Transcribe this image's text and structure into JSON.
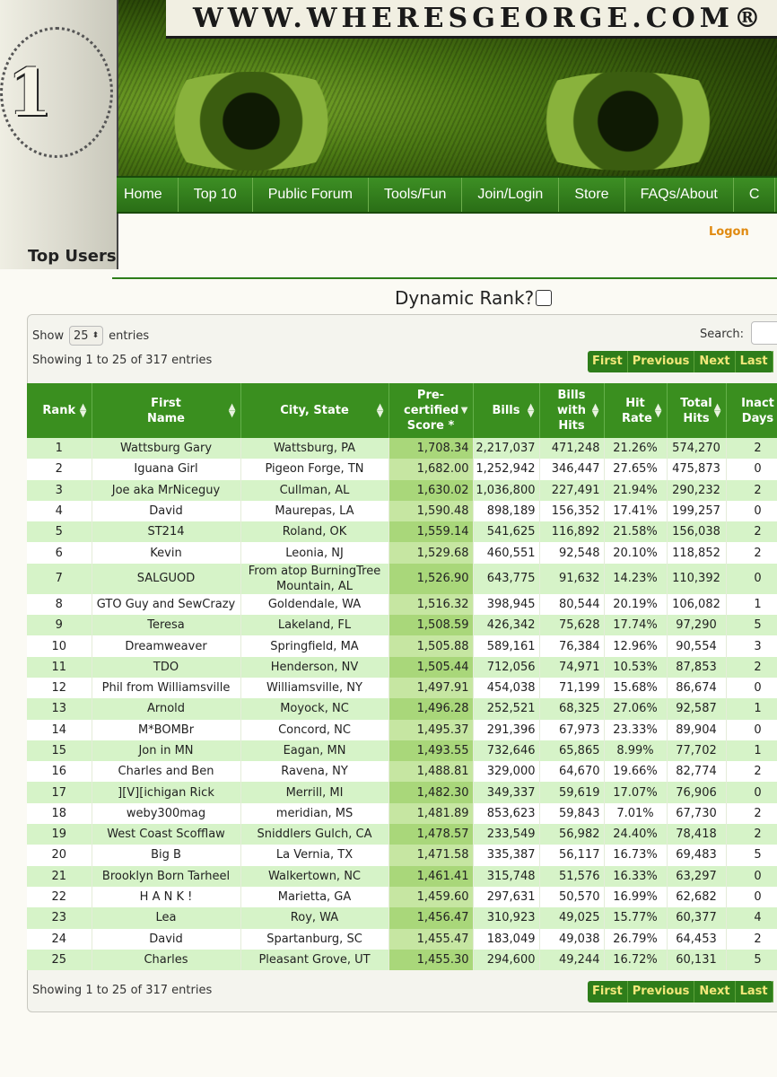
{
  "site": {
    "url_text": "WWW.WHERESGEORGE.COM®",
    "bill_numeral": "1"
  },
  "nav": [
    "Home",
    "Top 10",
    "Public Forum",
    "Tools/Fun",
    "Join/Login",
    "Store",
    "FAQs/About",
    "C"
  ],
  "logon": "Logon",
  "page_title": "Top Users",
  "dynamic_rank_label": "Dynamic Rank?",
  "controls": {
    "show_label": "Show",
    "entries_value": "25",
    "entries_label": "entries",
    "search_label": "Search:"
  },
  "info_text": "Showing 1 to 25 of 317 entries",
  "pager": [
    "First",
    "Previous",
    "Next",
    "Last"
  ],
  "columns": [
    {
      "label": "Rank",
      "sort": "both"
    },
    {
      "label": "First Name",
      "sort": "both"
    },
    {
      "label": "City, State",
      "sort": "both"
    },
    {
      "label": "Pre-certified Score *",
      "sort": "desc"
    },
    {
      "label": "Bills",
      "sort": "both"
    },
    {
      "label": "Bills with Hits",
      "sort": "both"
    },
    {
      "label": "Hit Rate",
      "sort": "both"
    },
    {
      "label": "Total Hits",
      "sort": "both"
    },
    {
      "label": "Inact Days",
      "sort": "both"
    }
  ],
  "rows": [
    [
      "1",
      "Wattsburg Gary",
      "Wattsburg, PA",
      "1,708.34",
      "2,217,037",
      "471,248",
      "21.26%",
      "574,270",
      "2"
    ],
    [
      "2",
      "Iguana Girl",
      "Pigeon Forge, TN",
      "1,682.00",
      "1,252,942",
      "346,447",
      "27.65%",
      "475,873",
      "0"
    ],
    [
      "3",
      "Joe aka MrNiceguy",
      "Cullman, AL",
      "1,630.02",
      "1,036,800",
      "227,491",
      "21.94%",
      "290,232",
      "2"
    ],
    [
      "4",
      "David",
      "Maurepas, LA",
      "1,590.48",
      "898,189",
      "156,352",
      "17.41%",
      "199,257",
      "0"
    ],
    [
      "5",
      "ST214",
      "Roland, OK",
      "1,559.14",
      "541,625",
      "116,892",
      "21.58%",
      "156,038",
      "2"
    ],
    [
      "6",
      "Kevin",
      "Leonia, NJ",
      "1,529.68",
      "460,551",
      "92,548",
      "20.10%",
      "118,852",
      "2"
    ],
    [
      "7",
      "SALGUOD",
      "From atop BurningTree Mountain, AL",
      "1,526.90",
      "643,775",
      "91,632",
      "14.23%",
      "110,392",
      "0"
    ],
    [
      "8",
      "GTO Guy and SewCrazy",
      "Goldendale, WA",
      "1,516.32",
      "398,945",
      "80,544",
      "20.19%",
      "106,082",
      "1"
    ],
    [
      "9",
      "Teresa",
      "Lakeland, FL",
      "1,508.59",
      "426,342",
      "75,628",
      "17.74%",
      "97,290",
      "5"
    ],
    [
      "10",
      "Dreamweaver",
      "Springfield, MA",
      "1,505.88",
      "589,161",
      "76,384",
      "12.96%",
      "90,554",
      "3"
    ],
    [
      "11",
      "TDO",
      "Henderson, NV",
      "1,505.44",
      "712,056",
      "74,971",
      "10.53%",
      "87,853",
      "2"
    ],
    [
      "12",
      "Phil from Williamsville",
      "Williamsville, NY",
      "1,497.91",
      "454,038",
      "71,199",
      "15.68%",
      "86,674",
      "0"
    ],
    [
      "13",
      "Arnold",
      "Moyock, NC",
      "1,496.28",
      "252,521",
      "68,325",
      "27.06%",
      "92,587",
      "1"
    ],
    [
      "14",
      "M*BOMBr",
      "Concord, NC",
      "1,495.37",
      "291,396",
      "67,973",
      "23.33%",
      "89,904",
      "0"
    ],
    [
      "15",
      "Jon in MN",
      "Eagan, MN",
      "1,493.55",
      "732,646",
      "65,865",
      "8.99%",
      "77,702",
      "1"
    ],
    [
      "16",
      "Charles and Ben",
      "Ravena, NY",
      "1,488.81",
      "329,000",
      "64,670",
      "19.66%",
      "82,774",
      "2"
    ],
    [
      "17",
      "][V][ichigan Rick",
      "Merrill, MI",
      "1,482.30",
      "349,337",
      "59,619",
      "17.07%",
      "76,906",
      "0"
    ],
    [
      "18",
      "weby300mag",
      "meridian, MS",
      "1,481.89",
      "853,623",
      "59,843",
      "7.01%",
      "67,730",
      "2"
    ],
    [
      "19",
      "West Coast Scofflaw",
      "Sniddlers Gulch, CA",
      "1,478.57",
      "233,549",
      "56,982",
      "24.40%",
      "78,418",
      "2"
    ],
    [
      "20",
      "Big B",
      "La Vernia, TX",
      "1,471.58",
      "335,387",
      "56,117",
      "16.73%",
      "69,483",
      "5"
    ],
    [
      "21",
      "Brooklyn Born Tarheel",
      "Walkertown, NC",
      "1,461.41",
      "315,748",
      "51,576",
      "16.33%",
      "63,297",
      "0"
    ],
    [
      "22",
      "H A N K !",
      "Marietta, GA",
      "1,459.60",
      "297,631",
      "50,570",
      "16.99%",
      "62,682",
      "0"
    ],
    [
      "23",
      "Lea",
      "Roy, WA",
      "1,456.47",
      "310,923",
      "49,025",
      "15.77%",
      "60,377",
      "4"
    ],
    [
      "24",
      "David",
      "Spartanburg, SC",
      "1,455.47",
      "183,049",
      "49,038",
      "26.79%",
      "64,453",
      "2"
    ],
    [
      "25",
      "Charles",
      "Pleasant Grove, UT",
      "1,455.30",
      "294,600",
      "49,244",
      "16.72%",
      "60,131",
      "5"
    ]
  ]
}
